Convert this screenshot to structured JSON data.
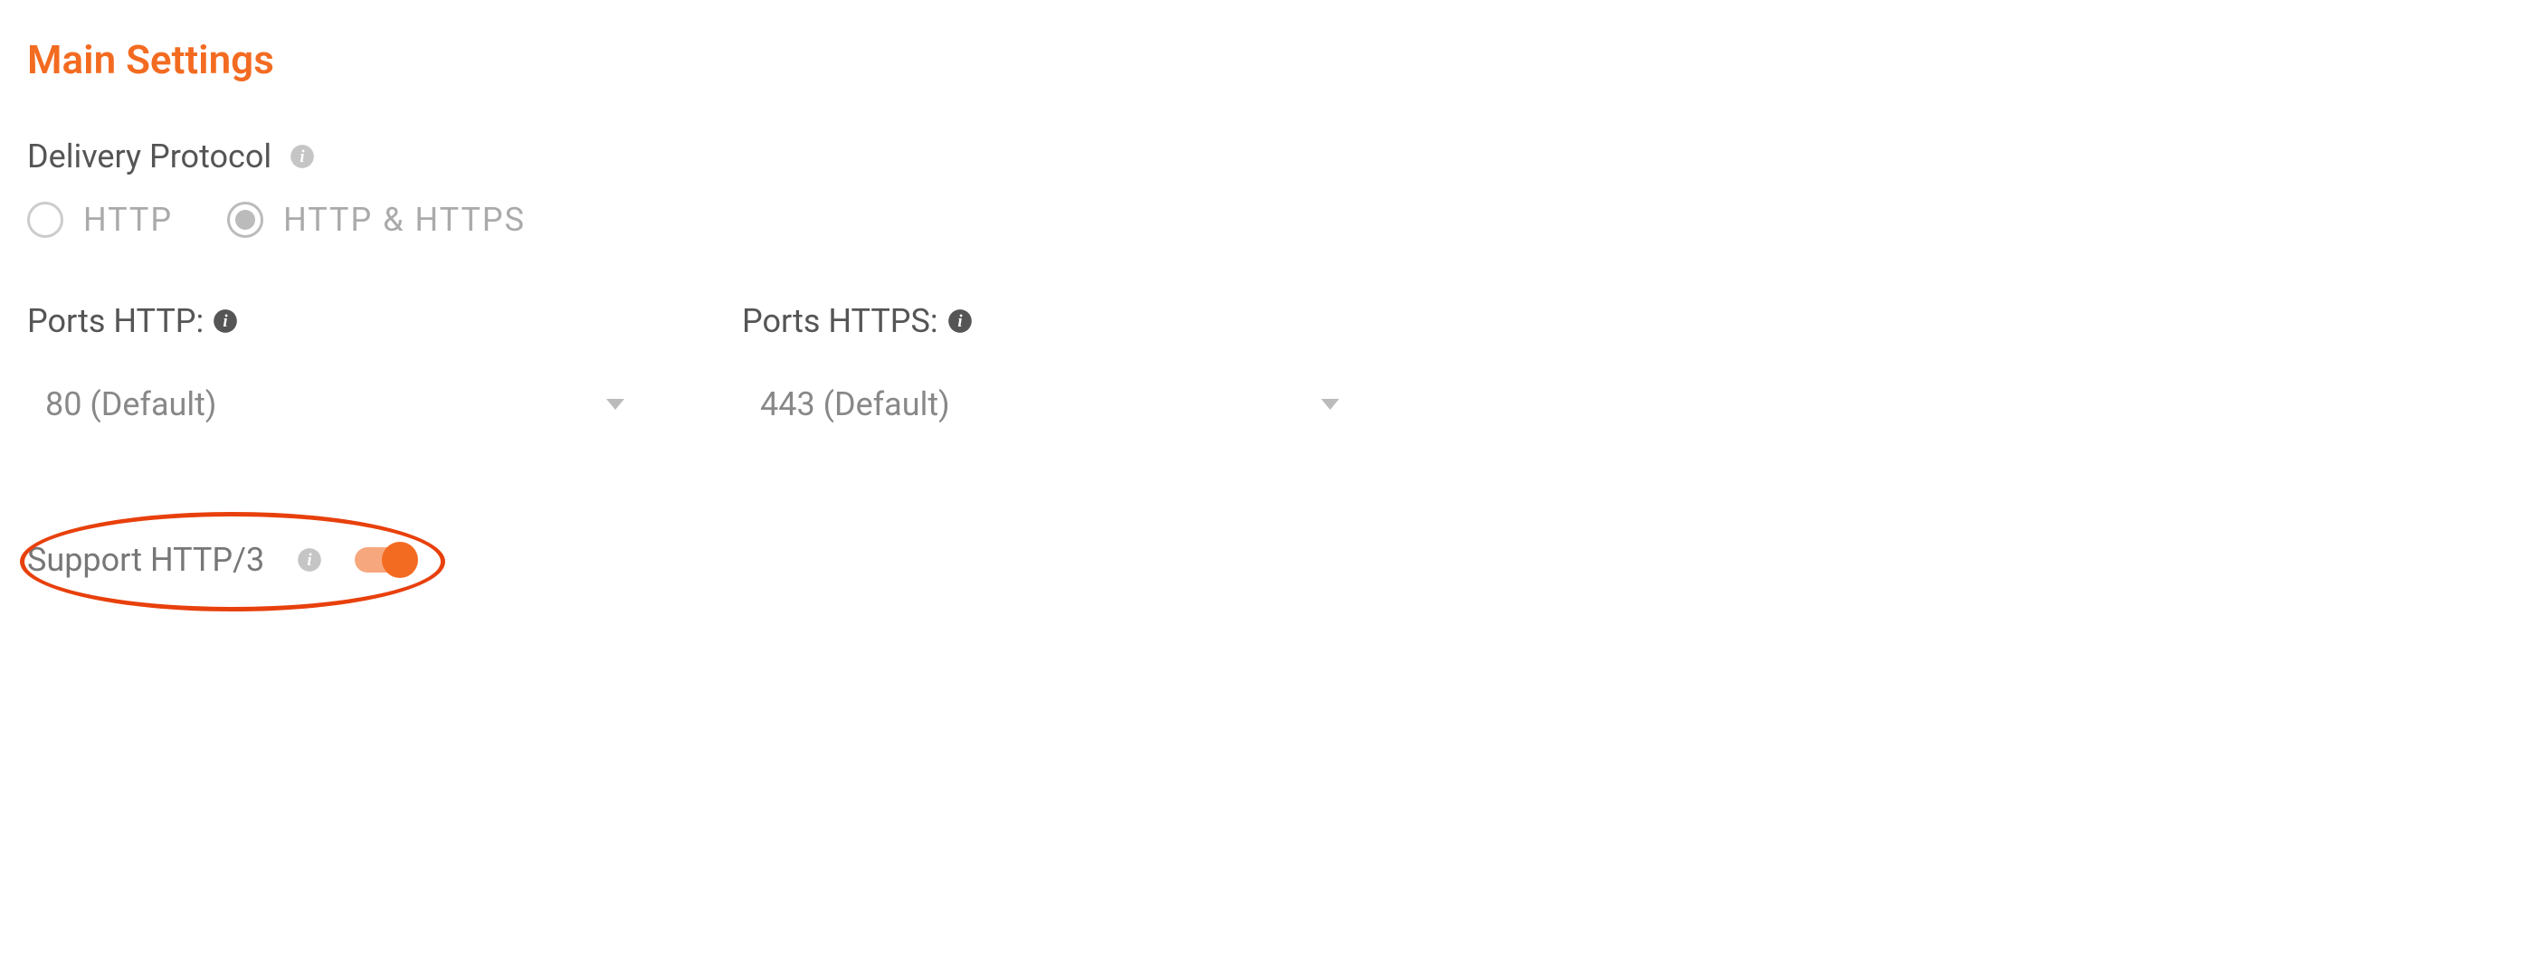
{
  "section": {
    "title": "Main Settings"
  },
  "delivery_protocol": {
    "label": "Delivery Protocol",
    "options": [
      {
        "label": "HTTP",
        "selected": false
      },
      {
        "label": "HTTP & HTTPS",
        "selected": true
      }
    ]
  },
  "ports_http": {
    "label": "Ports HTTP:",
    "value": "80 (Default)"
  },
  "ports_https": {
    "label": "Ports HTTPS:",
    "value": "443 (Default)"
  },
  "support_http3": {
    "label": "Support HTTP/3",
    "enabled": true
  },
  "colors": {
    "accent": "#f36b21",
    "highlight_border": "#e8400c"
  }
}
